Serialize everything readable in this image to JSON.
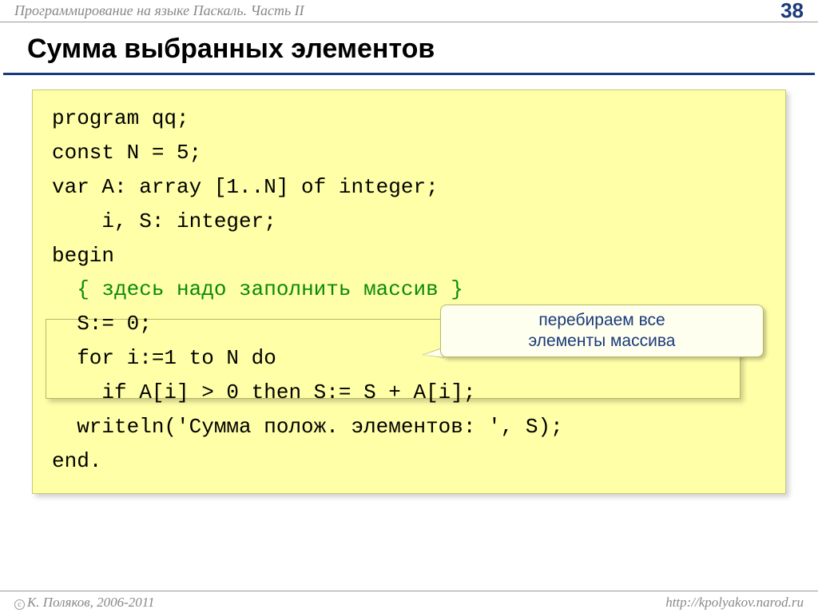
{
  "header": {
    "title": "Программирование на языке Паскаль. Часть II",
    "page": "38"
  },
  "slide": {
    "title": "Сумма выбранных элементов"
  },
  "code": {
    "l1": "program qq;",
    "l2": "const N = 5;",
    "l3": "var A: array [1..N] of integer;",
    "l4": "    i, S: integer;",
    "l5": "begin",
    "l6pre": "  ",
    "l6comment": "{ здесь надо заполнить массив }",
    "l7": "  S:= 0;",
    "l8": "  for i:=1 to N do",
    "l9": "    if A[i] > 0 then S:= S + A[i];",
    "l10": "  writeln('Сумма полож. элементов: ', S);",
    "l11": "end."
  },
  "callout": {
    "text": "перебираем все\nэлементы массива"
  },
  "footer": {
    "copyright": "К. Поляков, 2006-2011",
    "url": "http://kpolyakov.narod.ru"
  }
}
